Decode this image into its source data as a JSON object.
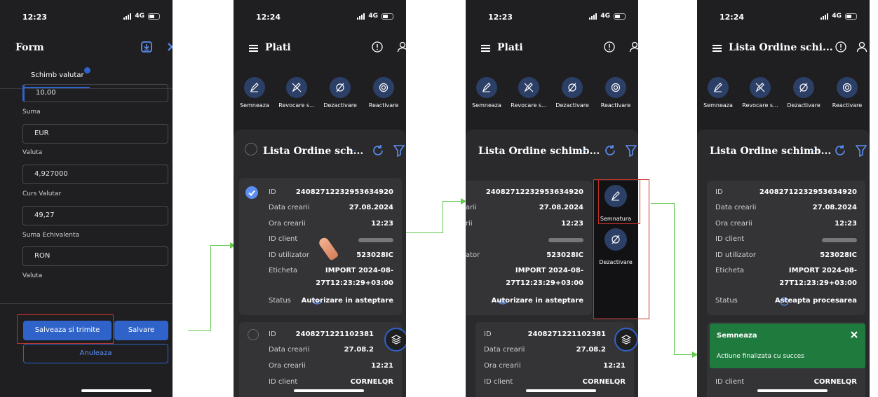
{
  "screens": [
    {
      "time": "12:23",
      "network": "4G",
      "header_title": "Form",
      "tab_label": "Schimb valutar",
      "fields": [
        {
          "value": "10,00",
          "label": "Suma"
        },
        {
          "value": "EUR",
          "label": "Valuta"
        },
        {
          "value": "4,927000",
          "label": "Curs Valutar"
        },
        {
          "value": "49,27",
          "label": "Suma Echivalenta"
        },
        {
          "value": "RON",
          "label": "Valuta"
        }
      ],
      "buttons": {
        "primary": "Salveaza si trimite",
        "secondary": "Salvare",
        "cancel": "Anuleaza"
      }
    },
    {
      "time": "12:24",
      "network": "4G",
      "header_title": "Plati",
      "actions": [
        "Semneaza",
        "Revocare s...",
        "Dezactivare",
        "Reactivare"
      ],
      "list_title": "Lista Ordine sch...",
      "card1": {
        "rows": [
          {
            "k": "ID",
            "v": "24082712232953634920"
          },
          {
            "k": "Data crearii",
            "v": "27.08.2024"
          },
          {
            "k": "Ora crearii",
            "v": "12:23"
          },
          {
            "k": "ID client",
            "v": ""
          },
          {
            "k": "ID utilizator",
            "v": "523028IC"
          },
          {
            "k": "Eticheta",
            "v": "IMPORT 2024-08-",
            "v2": "27T12:23:29+03:00"
          },
          {
            "k": "Status",
            "v": "Autorizare in asteptare"
          }
        ]
      },
      "card2": {
        "rows": [
          {
            "k": "ID",
            "v": "2408271221102381"
          },
          {
            "k": "Data crearii",
            "v": "27.08.2"
          },
          {
            "k": "Ora crearii",
            "v": "12:21"
          },
          {
            "k": "ID client",
            "v": "CORNELQR"
          }
        ]
      }
    },
    {
      "time": "12:23",
      "network": "4G",
      "header_title": "Plati",
      "actions": [
        "Semneaza",
        "Revocare s...",
        "Dezactivare",
        "Reactivare"
      ],
      "list_title": "Lista Ordine schimb...",
      "card1": {
        "rows": [
          {
            "k": "",
            "v": "24082712232953634920"
          },
          {
            "k": "arii",
            "v": "27.08.2024"
          },
          {
            "k": "rii",
            "v": "12:23"
          },
          {
            "k": "",
            "v": ""
          },
          {
            "k": "ator",
            "v": "523028IC"
          },
          {
            "k": "",
            "v": "IMPORT 2024-08-",
            "v2": "27T12:23:29+03:00"
          },
          {
            "k": "",
            "v": "Autorizare in asteptare"
          }
        ]
      },
      "swipe_actions": [
        "Semnatura",
        "Dezactivare"
      ],
      "card2": {
        "rows": [
          {
            "k": "ID",
            "v": "2408271221102381"
          },
          {
            "k": "Data crearii",
            "v": "27.08.2"
          },
          {
            "k": "Ora crearii",
            "v": "12:21"
          },
          {
            "k": "ID client",
            "v": "CORNELQR"
          }
        ]
      }
    },
    {
      "time": "12:24",
      "network": "4G",
      "header_title": "Lista Ordine schi...",
      "actions": [
        "Semneaza",
        "Revocare s...",
        "Dezactivare",
        "Reactivare"
      ],
      "list_title": "Lista Ordine schimb...",
      "card1": {
        "rows": [
          {
            "k": "ID",
            "v": "24082712232953634920"
          },
          {
            "k": "Data crearii",
            "v": "27.08.2024"
          },
          {
            "k": "Ora crearii",
            "v": "12:23"
          },
          {
            "k": "ID client",
            "v": ""
          },
          {
            "k": "ID utilizator",
            "v": "523028IC"
          },
          {
            "k": "Eticheta",
            "v": "IMPORT 2024-08-",
            "v2": "27T12:23:29+03:00"
          },
          {
            "k": "Status",
            "v": "Asteapta procesarea"
          }
        ]
      },
      "toast": {
        "title": "Semneaza",
        "message": "Actiune finalizata cu succes"
      },
      "card2": {
        "rows": [
          {
            "k": "ID client",
            "v": "CORNELQR"
          }
        ]
      }
    }
  ],
  "colors": {
    "background": "#1f1f22",
    "panel": "#2a2a2d",
    "card": "#343437",
    "accent": "#2f63c9",
    "action_circle": "#2c3f66",
    "toast": "#1f7a3e",
    "arrow": "#63c94e",
    "highlight": "#c6332a"
  },
  "icons": [
    "battery-icon",
    "signal-icon",
    "menu-icon",
    "shield-icon",
    "user-icon",
    "download-icon",
    "close-icon",
    "pen-icon",
    "revoke-icon",
    "deactivate-icon",
    "reactivate-icon",
    "refresh-icon",
    "filter-icon",
    "more-icon",
    "layers-icon",
    "check-icon",
    "eye-icon",
    "clock-icon"
  ]
}
